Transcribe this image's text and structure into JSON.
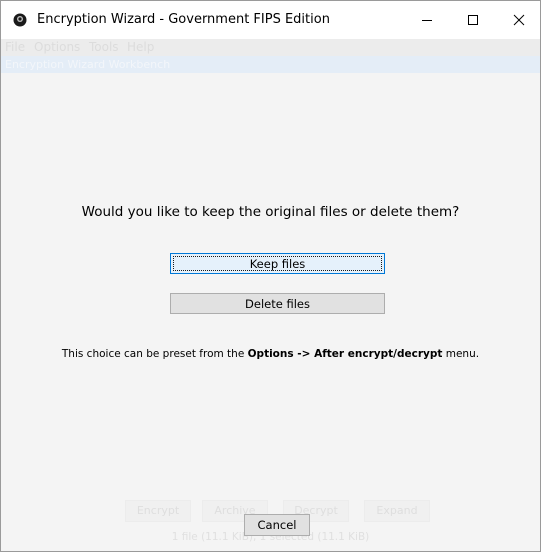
{
  "window": {
    "title": "Encryption Wizard - Government FIPS Edition"
  },
  "menubar": {
    "items": [
      "File",
      "Options",
      "Tools",
      "Help"
    ]
  },
  "ghost_bar": {
    "text": "Encryption Wizard Workbench"
  },
  "dialog": {
    "question": "Would you like to keep the original files or delete them?",
    "keep_label": "Keep files",
    "delete_label": "Delete files",
    "hint_prefix": "This choice can be preset from the ",
    "hint_menu": "Options -> After encrypt/decrypt",
    "hint_suffix": " menu.",
    "cancel_label": "Cancel"
  },
  "ghost_toolbar": {
    "buttons": [
      "Encrypt",
      "Archive",
      "Decrypt",
      "Expand"
    ],
    "status": "1 file (11.1 KiB), 1 selected (11.1 KiB)"
  },
  "colors": {
    "accent": "#0078d7",
    "dialog_bg": "#f4f4f4"
  }
}
